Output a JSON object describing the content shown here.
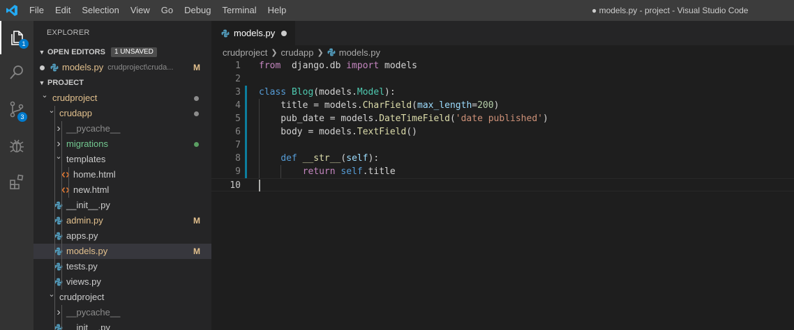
{
  "window": {
    "title": "● models.py - project - Visual Studio Code",
    "menu": [
      "File",
      "Edit",
      "Selection",
      "View",
      "Go",
      "Debug",
      "Terminal",
      "Help"
    ]
  },
  "activity_bar": {
    "items": [
      {
        "name": "explorer",
        "badge": "1"
      },
      {
        "name": "search",
        "badge": ""
      },
      {
        "name": "source-control",
        "badge": "3"
      },
      {
        "name": "debug",
        "badge": ""
      },
      {
        "name": "extensions",
        "badge": ""
      }
    ]
  },
  "sidebar": {
    "title": "EXPLORER",
    "open_editors": {
      "label": "OPEN EDITORS",
      "badge": "1 UNSAVED",
      "file": {
        "name": "models.py",
        "path": "crudproject\\cruda...",
        "status": "M"
      }
    },
    "project": {
      "label": "PROJECT",
      "tree": [
        {
          "label": "crudproject",
          "kind": "folder-open",
          "depth": 1,
          "color": "mod",
          "dot": "#8c8c8c"
        },
        {
          "label": "crudapp",
          "kind": "folder-open",
          "depth": 2,
          "color": "mod",
          "dot": "#8c8c8c"
        },
        {
          "label": "__pycache__",
          "kind": "folder",
          "depth": 3,
          "color": "ign"
        },
        {
          "label": "migrations",
          "kind": "folder",
          "depth": 3,
          "color": "new",
          "dot": "#5a9e62"
        },
        {
          "label": "templates",
          "kind": "folder-open",
          "depth": 3,
          "color": "def"
        },
        {
          "label": "home.html",
          "kind": "html",
          "depth": 4,
          "color": "def"
        },
        {
          "label": "new.html",
          "kind": "html",
          "depth": 4,
          "color": "def"
        },
        {
          "label": "__init__.py",
          "kind": "py",
          "depth": 3,
          "color": "def"
        },
        {
          "label": "admin.py",
          "kind": "py",
          "depth": 3,
          "color": "mod",
          "status": "M"
        },
        {
          "label": "apps.py",
          "kind": "py",
          "depth": 3,
          "color": "def"
        },
        {
          "label": "models.py",
          "kind": "py",
          "depth": 3,
          "color": "mod",
          "status": "M",
          "selected": true
        },
        {
          "label": "tests.py",
          "kind": "py",
          "depth": 3,
          "color": "def"
        },
        {
          "label": "views.py",
          "kind": "py",
          "depth": 3,
          "color": "def"
        },
        {
          "label": "crudproject",
          "kind": "folder-open",
          "depth": 2,
          "color": "def"
        },
        {
          "label": "__pycache__",
          "kind": "folder",
          "depth": 3,
          "color": "ign"
        },
        {
          "label": "__init__.py",
          "kind": "py",
          "depth": 3,
          "color": "def"
        }
      ]
    }
  },
  "editor": {
    "tab": {
      "label": "models.py",
      "unsaved": true
    },
    "breadcrumb": [
      "crudproject",
      "crudapp",
      "models.py"
    ],
    "lines": [
      {
        "n": "1",
        "tokens": [
          [
            "kw2",
            "from"
          ],
          [
            "",
            "  django.db "
          ],
          [
            "kw2",
            "import"
          ],
          [
            "",
            " models"
          ]
        ]
      },
      {
        "n": "2",
        "tokens": []
      },
      {
        "n": "3",
        "tokens": [
          [
            "kw",
            "class"
          ],
          [
            "",
            " "
          ],
          [
            "cls",
            "Blog"
          ],
          [
            "",
            "("
          ],
          [
            "",
            "models."
          ],
          [
            "cls",
            "Model"
          ],
          [
            "",
            "):"
          ]
        ]
      },
      {
        "n": "4",
        "tokens": [
          [
            "",
            "    title = models."
          ],
          [
            "fn",
            "CharField"
          ],
          [
            "",
            "("
          ],
          [
            "var",
            "max_length"
          ],
          [
            "",
            "="
          ],
          [
            "num",
            "200"
          ],
          [
            "",
            ")"
          ]
        ]
      },
      {
        "n": "5",
        "tokens": [
          [
            "",
            "    pub_date = models."
          ],
          [
            "fn",
            "DateTimeField"
          ],
          [
            "",
            "("
          ],
          [
            "str",
            "'date published'"
          ],
          [
            "",
            ")"
          ]
        ]
      },
      {
        "n": "6",
        "tokens": [
          [
            "",
            "    body = models."
          ],
          [
            "fn",
            "TextField"
          ],
          [
            "",
            "()"
          ]
        ]
      },
      {
        "n": "7",
        "tokens": []
      },
      {
        "n": "8",
        "tokens": [
          [
            "",
            "    "
          ],
          [
            "kw",
            "def"
          ],
          [
            "",
            " "
          ],
          [
            "fn",
            "__str__"
          ],
          [
            "",
            "("
          ],
          [
            "var",
            "self"
          ],
          [
            "",
            "):"
          ]
        ]
      },
      {
        "n": "9",
        "tokens": [
          [
            "",
            "        "
          ],
          [
            "kw2",
            "return"
          ],
          [
            "",
            " "
          ],
          [
            "kw",
            "self"
          ],
          [
            "",
            ".title"
          ]
        ]
      },
      {
        "n": "10",
        "tokens": []
      }
    ]
  }
}
